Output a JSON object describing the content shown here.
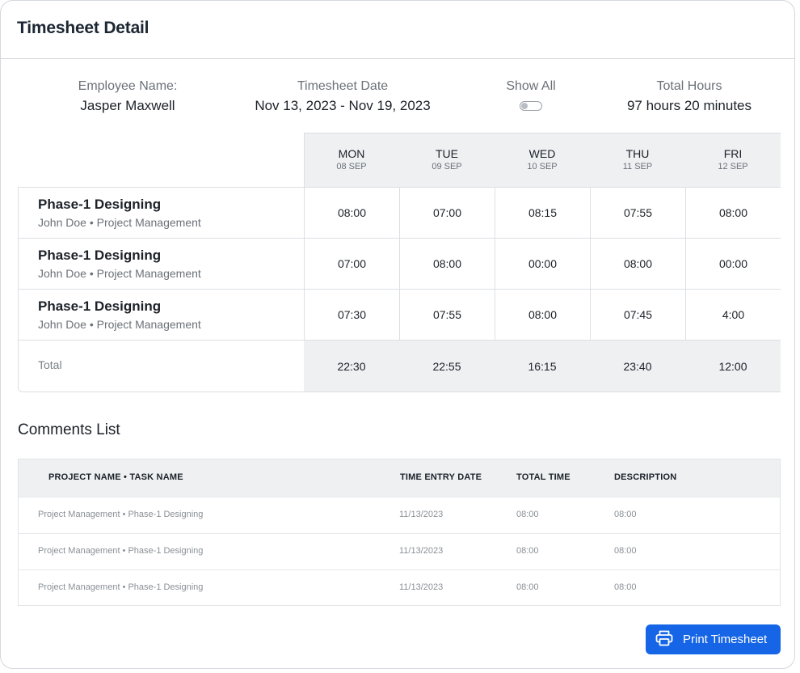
{
  "header": {
    "title": "Timesheet Detail"
  },
  "summary": {
    "employee_label": "Employee Name:",
    "employee_value": "Jasper Maxwell",
    "date_label": "Timesheet Date",
    "date_value": "Nov 13, 2023 - Nov 19, 2023",
    "show_all_label": "Show All",
    "show_all_on": false,
    "total_label": "Total Hours",
    "total_value": "97 hours 20 minutes"
  },
  "days": [
    {
      "name": "MON",
      "date": "08 SEP"
    },
    {
      "name": "TUE",
      "date": "09 SEP"
    },
    {
      "name": "WED",
      "date": "10 SEP"
    },
    {
      "name": "THU",
      "date": "11 SEP"
    },
    {
      "name": "FRI",
      "date": "12 SEP"
    }
  ],
  "rows": [
    {
      "task": "Phase-1 Designing",
      "sub": "John Doe • Project Management",
      "times": [
        "08:00",
        "07:00",
        "08:15",
        "07:55",
        "08:00"
      ]
    },
    {
      "task": "Phase-1 Designing",
      "sub": "John Doe • Project Management",
      "times": [
        "07:00",
        "08:00",
        "00:00",
        "08:00",
        "00:00"
      ]
    },
    {
      "task": "Phase-1 Designing",
      "sub": "John Doe • Project Management",
      "times": [
        "07:30",
        "07:55",
        "08:00",
        "07:45",
        "4:00"
      ]
    }
  ],
  "totals": {
    "label": "Total",
    "values": [
      "22:30",
      "22:55",
      "16:15",
      "23:40",
      "12:00"
    ]
  },
  "comments": {
    "title": "Comments List",
    "headers": [
      "PROJECT NAME • TASK NAME",
      "TIME ENTRY DATE",
      "TOTAL TIME",
      "DESCRIPTION"
    ],
    "rows": [
      [
        "Project Management • Phase-1 Designing",
        "11/13/2023",
        "08:00",
        "08:00"
      ],
      [
        "Project Management • Phase-1 Designing",
        "11/13/2023",
        "08:00",
        "08:00"
      ],
      [
        "Project Management • Phase-1 Designing",
        "11/13/2023",
        "08:00",
        "08:00"
      ]
    ]
  },
  "actions": {
    "print_label": "Print Timesheet",
    "print_icon": "printer-icon"
  },
  "colors": {
    "primary": "#1565e6",
    "header_bg": "#eef0f2",
    "border": "#dcdfe3"
  }
}
